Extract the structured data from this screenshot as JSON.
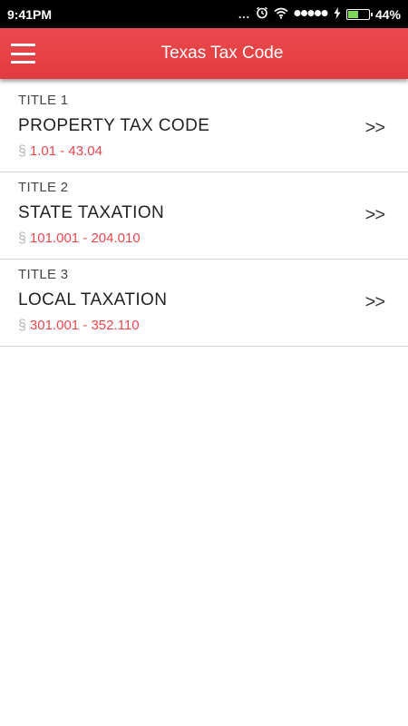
{
  "status_bar": {
    "time": "9:41PM",
    "dots": "...",
    "battery_percent": "44%",
    "battery_level": 0.44,
    "icons": [
      "alarm-icon",
      "wifi-icon",
      "signal-icon",
      "charging-icon",
      "battery-icon"
    ]
  },
  "app_bar": {
    "title": "Texas Tax Code",
    "menu_icon": "hamburger-menu-icon",
    "color": "#e5413f"
  },
  "titles": [
    {
      "label": "TITLE 1",
      "name": "PROPERTY TAX CODE",
      "section_symbol": "§",
      "range": "1.01 - 43.04",
      "chevron": ">>"
    },
    {
      "label": "TITLE 2",
      "name": "STATE TAXATION",
      "section_symbol": "§",
      "range": "101.001 - 204.010",
      "chevron": ">>"
    },
    {
      "label": "TITLE 3",
      "name": "LOCAL TAXATION",
      "section_symbol": "§",
      "range": "301.001 - 352.110",
      "chevron": ">>"
    }
  ]
}
